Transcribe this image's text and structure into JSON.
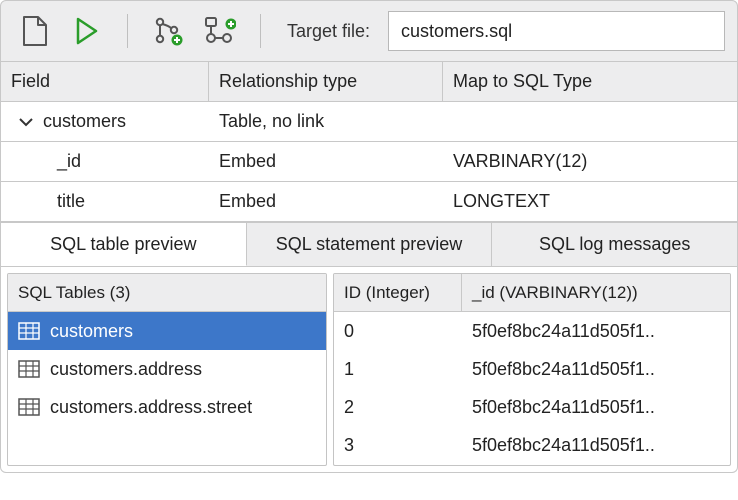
{
  "toolbar": {
    "target_label": "Target file:",
    "target_value": "customers.sql"
  },
  "mapping": {
    "headers": {
      "field": "Field",
      "reltype": "Relationship type",
      "mapto": "Map to SQL Type"
    },
    "rows": [
      {
        "field": "customers",
        "reltype": "Table, no link",
        "mapto": "",
        "indent": 0,
        "expandable": true
      },
      {
        "field": "_id",
        "reltype": "Embed",
        "mapto": "VARBINARY(12)",
        "indent": 1,
        "expandable": false
      },
      {
        "field": "title",
        "reltype": "Embed",
        "mapto": "LONGTEXT",
        "indent": 1,
        "expandable": false
      }
    ]
  },
  "tabs": {
    "items": [
      {
        "label": "SQL table preview",
        "active": true
      },
      {
        "label": "SQL statement preview",
        "active": false
      },
      {
        "label": "SQL log messages",
        "active": false
      }
    ]
  },
  "sql_tables": {
    "header": "SQL Tables (3)",
    "items": [
      {
        "name": "customers",
        "selected": true
      },
      {
        "name": "customers.address",
        "selected": false
      },
      {
        "name": "customers.address.street",
        "selected": false
      }
    ]
  },
  "preview_data": {
    "headers": {
      "id": "ID (Integer)",
      "bin": "_id (VARBINARY(12))"
    },
    "rows": [
      {
        "id": "0",
        "bin": "5f0ef8bc24a11d505f1.."
      },
      {
        "id": "1",
        "bin": "5f0ef8bc24a11d505f1.."
      },
      {
        "id": "2",
        "bin": "5f0ef8bc24a11d505f1.."
      },
      {
        "id": "3",
        "bin": "5f0ef8bc24a11d505f1.."
      }
    ]
  }
}
